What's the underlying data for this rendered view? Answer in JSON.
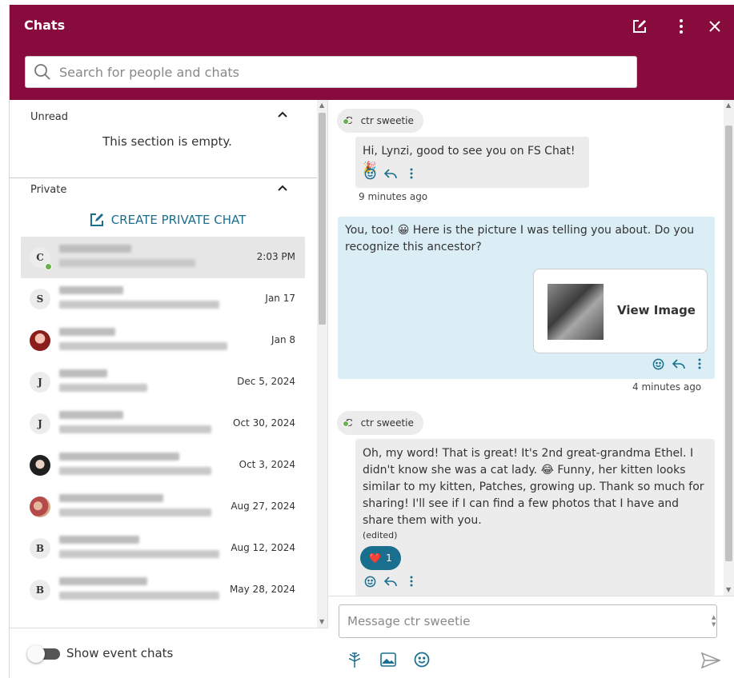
{
  "header": {
    "title": "Chats",
    "icons": [
      "new-chat-icon",
      "more-vert-icon",
      "close-icon"
    ]
  },
  "search": {
    "placeholder": "Search for people and chats"
  },
  "sections": {
    "unread": {
      "label": "Unread",
      "empty_text": "This section is empty."
    },
    "private": {
      "label": "Private",
      "create_label": "CREATE PRIVATE CHAT"
    }
  },
  "chats": [
    {
      "initial": "C",
      "date": "2:03 PM",
      "online": true,
      "active": true
    },
    {
      "initial": "S",
      "date": "Jan 17"
    },
    {
      "initial": "",
      "date": "Jan 8",
      "avatar": "photo1"
    },
    {
      "initial": "J",
      "date": "Dec 5, 2024"
    },
    {
      "initial": "J",
      "date": "Oct 30, 2024"
    },
    {
      "initial": "",
      "date": "Oct 3, 2024",
      "avatar": "photo2"
    },
    {
      "initial": "",
      "date": "Aug 27, 2024",
      "avatar": "photo3"
    },
    {
      "initial": "B",
      "date": "Aug 12, 2024"
    },
    {
      "initial": "B",
      "date": "May 28, 2024"
    }
  ],
  "footer": {
    "toggle_label": "Show event chats",
    "toggle_on": false
  },
  "conversation": {
    "sender": {
      "initial": "C",
      "name": "ctr sweetie"
    },
    "msg1": {
      "text": "Hi, Lynzi, good to see you on FS Chat! 🎉",
      "time": "9 minutes ago"
    },
    "msg2": {
      "text": "You, too! 😀 Here is the picture I was telling you about. Do you recognize this ancestor?",
      "image_label": "View Image",
      "time": "4 minutes ago"
    },
    "msg3": {
      "text": "Oh, my word! That is great! It's 2nd great-grandma Ethel. I didn't know she was a cat lady. 😂 Funny, her kitten looks similar to my kitten, Patches, growing up. Thank so much for sharing! I'll see if I can find a few photos that I have and share them with you.",
      "edited": "(edited)",
      "reaction": {
        "emoji": "❤️",
        "count": "1"
      }
    }
  },
  "compose": {
    "placeholder": "Message ctr sweetie",
    "tools": [
      "tree-icon",
      "image-icon",
      "emoji-icon"
    ],
    "send_icon": "send-icon"
  },
  "colors": {
    "brand": "#880b3e",
    "accent": "#1a6f8f",
    "self_bubble": "#dbeef6",
    "other_bubble": "#ececec",
    "online": "#6ab04c"
  }
}
